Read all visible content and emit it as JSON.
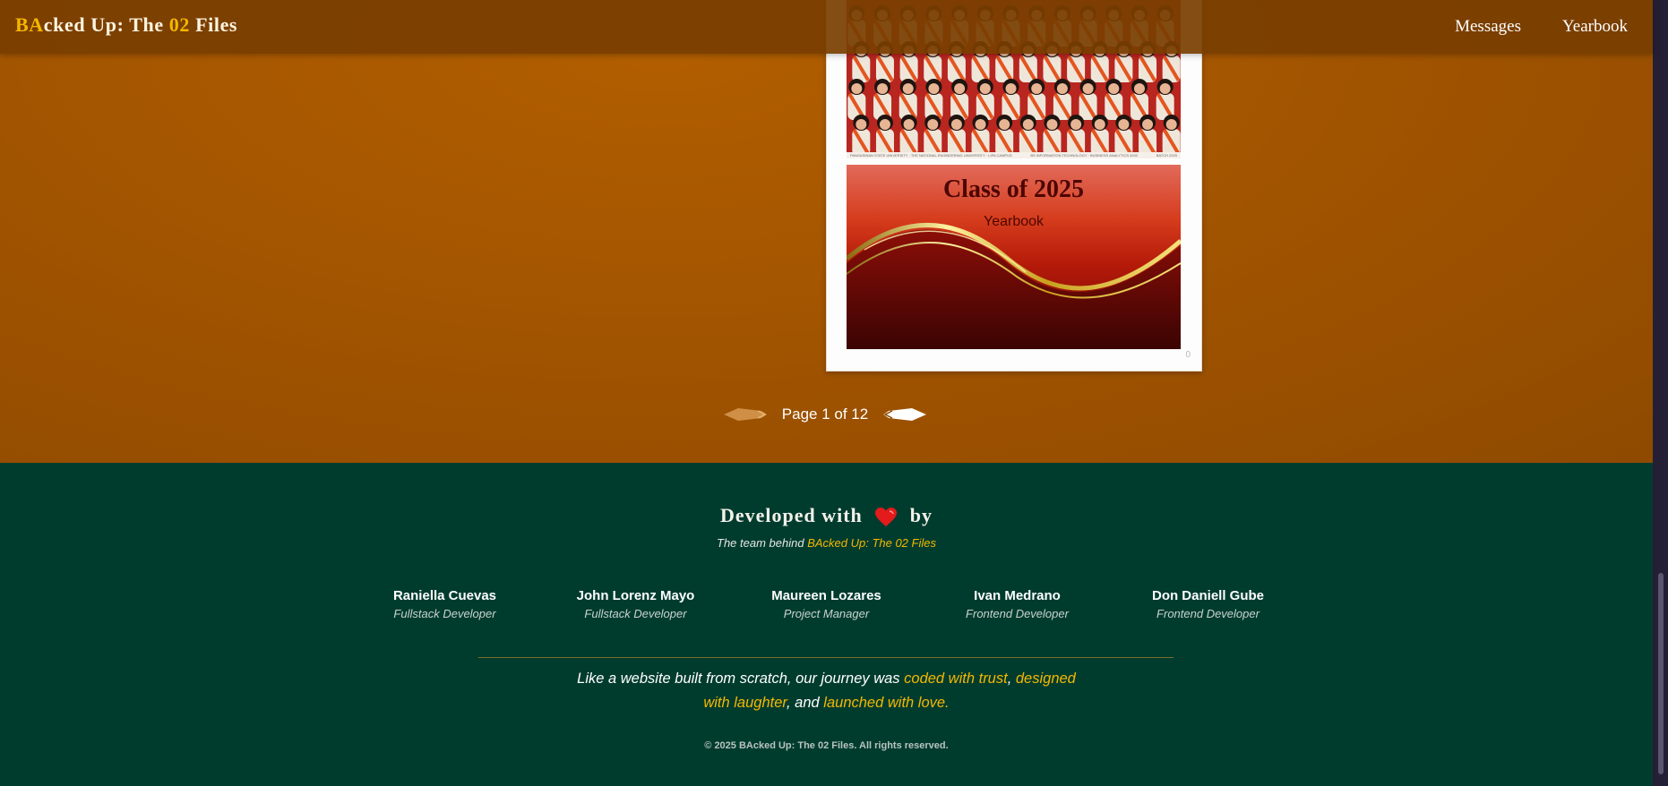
{
  "navbar": {
    "brand": {
      "part1": "BA",
      "part2": "cked Up: The ",
      "part3": "02",
      "part4": " Files"
    },
    "links": [
      {
        "label": "Messages"
      },
      {
        "label": "Yearbook"
      }
    ]
  },
  "yearbook": {
    "photo_strip_left": "PANGASINAN STATE UNIVERSITY · THE NATIONAL ENGINEERING UNIVERSITY · LIPA CAMPUS",
    "photo_strip_mid": "BS INFORMATION TECHNOLOGY · BUSINESS ANALYTICS 4202",
    "photo_strip_right": "BATCH 2025",
    "cover_title": "Class of 2025",
    "cover_subtitle": "Yearbook",
    "page_marker": "0"
  },
  "pagination": {
    "label": "Page 1 of 12"
  },
  "footer": {
    "title_pre": "Developed with",
    "title_post": "by",
    "team_line_pre": "The team behind ",
    "team_line_link": "BAcked Up: The 02 Files",
    "members": [
      {
        "name": "Raniella Cuevas",
        "role": "Fullstack Developer"
      },
      {
        "name": "John Lorenz Mayo",
        "role": "Fullstack Developer"
      },
      {
        "name": "Maureen Lozares",
        "role": "Project Manager"
      },
      {
        "name": "Ivan Medrano",
        "role": "Frontend Developer"
      },
      {
        "name": "Don Daniell Gube",
        "role": "Frontend Developer"
      }
    ],
    "quote": {
      "p1": "Like a website built from scratch, our journey was ",
      "h1": "coded with trust",
      "p2": ", ",
      "h2": "designed with laughter",
      "p3": ", and ",
      "h3": "launched with love.",
      "p4": ""
    },
    "copyright": "© 2025 BAcked Up: The 02 Files. All rights reserved."
  },
  "colors": {
    "accent": "#f5b700",
    "hero_bg": "#a35500",
    "footer_bg": "#003c2e",
    "cover_red": "#b31908"
  }
}
